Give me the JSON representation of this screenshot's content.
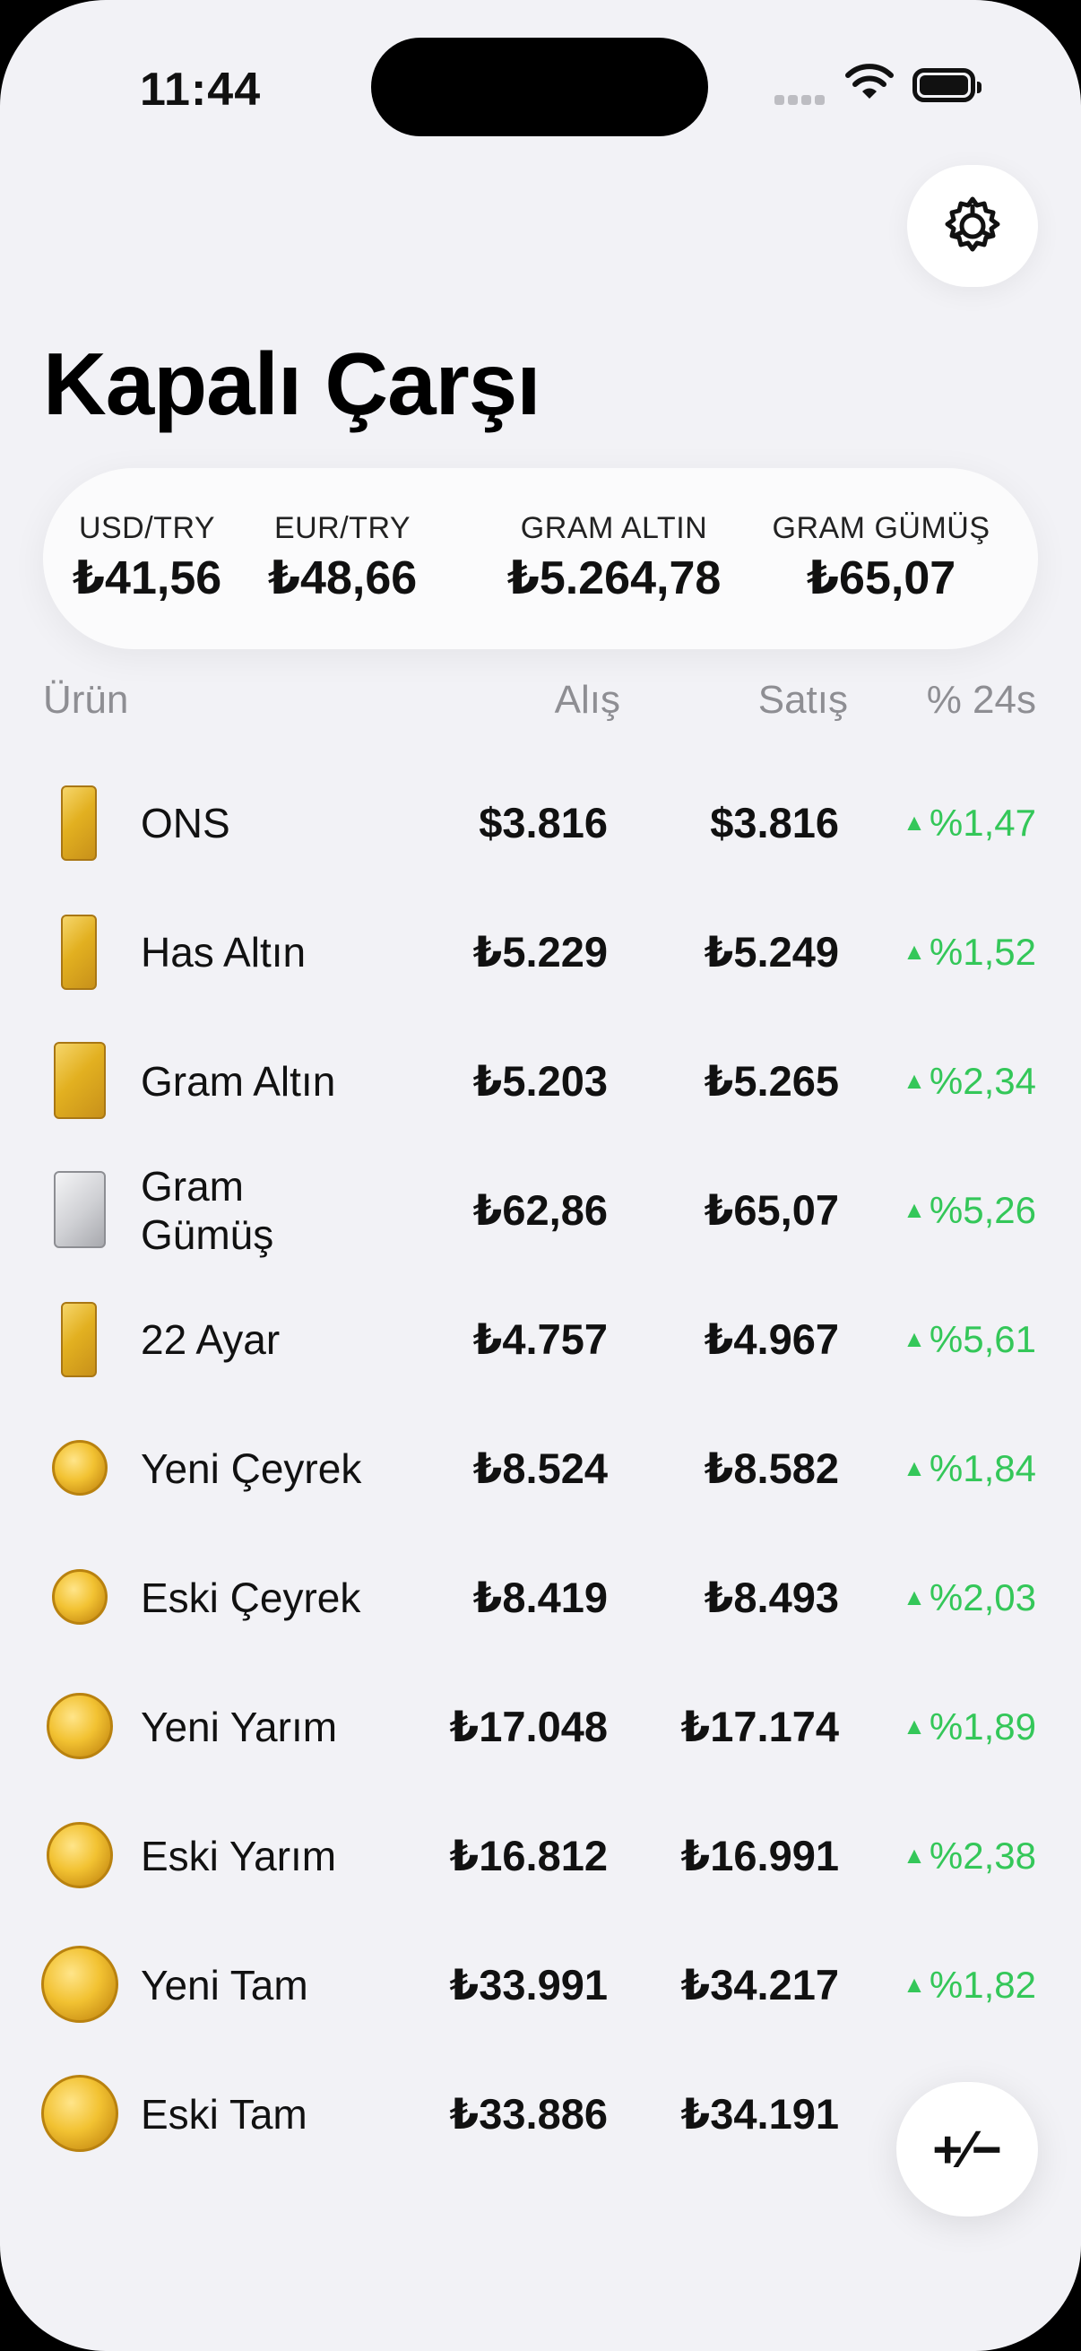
{
  "status_bar": {
    "time": "11:44"
  },
  "header": {
    "title": "Kapalı Çarşı",
    "settings_icon": "gear-icon"
  },
  "rates": [
    {
      "label": "USD/TRY",
      "value": "₺41,56"
    },
    {
      "label": "EUR/TRY",
      "value": "₺48,66"
    },
    {
      "label": "GRAM ALTIN",
      "value": "₺5.264,78"
    },
    {
      "label": "GRAM GÜMÜŞ",
      "value": "₺65,07"
    }
  ],
  "table": {
    "headers": {
      "product": "Ürün",
      "buy": "Alış",
      "sell": "Satış",
      "change": "% 24s"
    },
    "rows": [
      {
        "name": "ONS",
        "buy": "$3.816",
        "sell": "$3.816",
        "change": "%1,47",
        "icon": "gold-bar-icon"
      },
      {
        "name": "Has Altın",
        "buy": "₺5.229",
        "sell": "₺5.249",
        "change": "%1,52",
        "icon": "gold-bar-icon"
      },
      {
        "name": "Gram Altın",
        "buy": "₺5.203",
        "sell": "₺5.265",
        "change": "%2,34",
        "icon": "gram-gold-bar-icon"
      },
      {
        "name": "Gram Gümüş",
        "buy": "₺62,86",
        "sell": "₺65,07",
        "change": "%5,26",
        "icon": "silver-bar-icon"
      },
      {
        "name": "22 Ayar",
        "buy": "₺4.757",
        "sell": "₺4.967",
        "change": "%5,61",
        "icon": "gold-bar-icon"
      },
      {
        "name": "Yeni Çeyrek",
        "buy": "₺8.524",
        "sell": "₺8.582",
        "change": "%1,84",
        "icon": "gold-coin-icon"
      },
      {
        "name": "Eski Çeyrek",
        "buy": "₺8.419",
        "sell": "₺8.493",
        "change": "%2,03",
        "icon": "gold-coin-icon"
      },
      {
        "name": "Yeni Yarım",
        "buy": "₺17.048",
        "sell": "₺17.174",
        "change": "%1,89",
        "icon": "gold-coin-icon"
      },
      {
        "name": "Eski Yarım",
        "buy": "₺16.812",
        "sell": "₺16.991",
        "change": "%2,38",
        "icon": "gold-coin-icon"
      },
      {
        "name": "Yeni Tam",
        "buy": "₺33.991",
        "sell": "₺34.217",
        "change": "%1,82",
        "icon": "gold-coin-icon"
      },
      {
        "name": "Eski Tam",
        "buy": "₺33.886",
        "sell": "₺34.191",
        "change": "",
        "icon": "gold-coin-icon"
      }
    ]
  },
  "fab": {
    "label": "+⁄−",
    "icon": "plus-minus-icon"
  },
  "colors": {
    "background": "#f2f2f6",
    "positive": "#34c759",
    "text": "#111111"
  }
}
